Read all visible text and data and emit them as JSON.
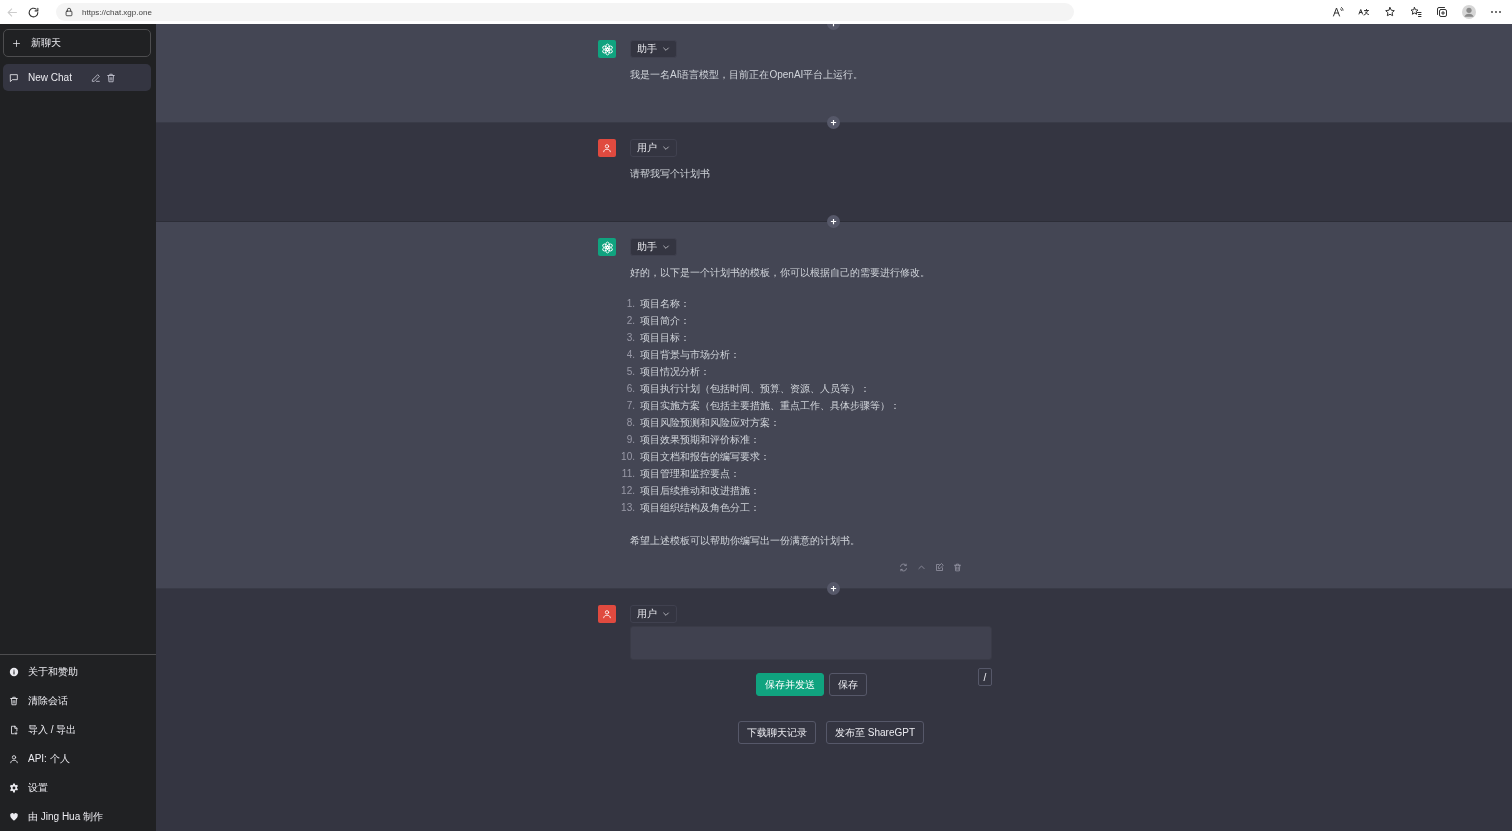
{
  "browser": {
    "url": "https://chat.xgp.one"
  },
  "sidebar": {
    "new_chat": "新聊天",
    "conversations": [
      {
        "title": "New Chat",
        "selected": true
      }
    ],
    "menu": [
      {
        "kind": "info",
        "label": "关于和赞助"
      },
      {
        "kind": "trash",
        "label": "清除会话"
      },
      {
        "kind": "file",
        "label": "导入 / 导出"
      },
      {
        "kind": "user",
        "label": "API: 个人"
      },
      {
        "kind": "gear",
        "label": "设置"
      },
      {
        "kind": "heart",
        "label": "由 Jing Hua 制作"
      }
    ]
  },
  "messages": [
    {
      "kind": "assistant",
      "role": "助手",
      "blocks": [
        {
          "kind": "paragraph",
          "text": "我是一名AI语言模型，目前正在OpenAI平台上运行。"
        }
      ]
    },
    {
      "kind": "user",
      "role": "用户",
      "blocks": [
        {
          "kind": "paragraph",
          "text": "请帮我写个计划书"
        }
      ]
    },
    {
      "kind": "assistant",
      "role": "助手",
      "show_actions": true,
      "blocks": [
        {
          "kind": "paragraph",
          "text": "好的，以下是一个计划书的模板，你可以根据自己的需要进行修改。"
        },
        {
          "kind": "list",
          "items": [
            {
              "number": "1.",
              "text": "项目名称："
            },
            {
              "number": "2.",
              "text": "项目简介："
            },
            {
              "number": "3.",
              "text": "项目目标："
            },
            {
              "number": "4.",
              "text": "项目背景与市场分析："
            },
            {
              "number": "5.",
              "text": "项目情况分析："
            },
            {
              "number": "6.",
              "text": "项目执行计划（包括时间、预算、资源、人员等）："
            },
            {
              "number": "7.",
              "text": "项目实施方案（包括主要措施、重点工作、具体步骤等）："
            },
            {
              "number": "8.",
              "text": "项目风险预测和风险应对方案："
            },
            {
              "number": "9.",
              "text": "项目效果预期和评价标准："
            },
            {
              "number": "10.",
              "text": "项目文档和报告的编写要求："
            },
            {
              "number": "11.",
              "text": "项目管理和监控要点："
            },
            {
              "number": "12.",
              "text": "项目后续推动和改进措施："
            },
            {
              "number": "13.",
              "text": "项目组织结构及角色分工："
            }
          ]
        },
        {
          "kind": "paragraph",
          "text": "希望上述模板可以帮助你编写出一份满意的计划书。"
        }
      ]
    },
    {
      "kind": "user",
      "role": "用户",
      "editing": true,
      "buttons": [
        {
          "label": "保存并发送",
          "primary": true
        },
        {
          "label": "保存",
          "primary": false
        }
      ],
      "shortcut": "/"
    }
  ],
  "footer": {
    "buttons": [
      "下载聊天记录",
      "发布至 ShareGPT"
    ]
  }
}
